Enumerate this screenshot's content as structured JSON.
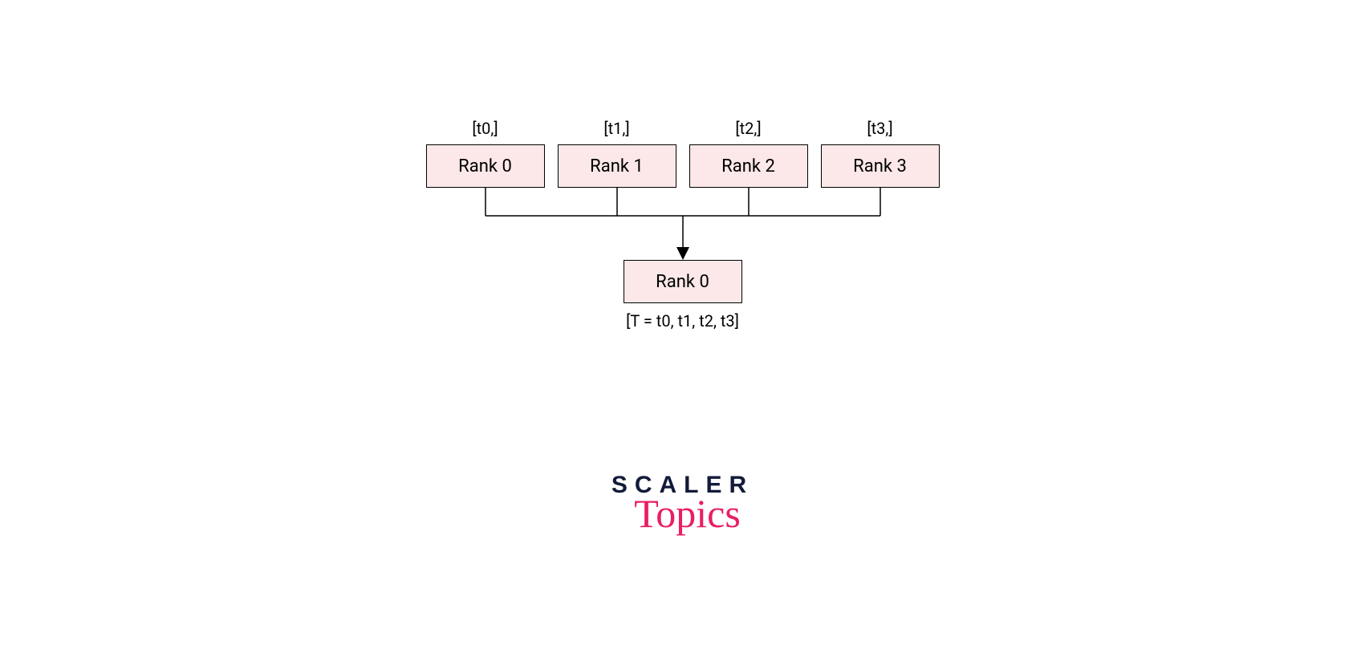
{
  "nodes": {
    "top": [
      {
        "label": "[t0,]",
        "box": "Rank 0"
      },
      {
        "label": "[t1,]",
        "box": "Rank 1"
      },
      {
        "label": "[t2,]",
        "box": "Rank 2"
      },
      {
        "label": "[t3,]",
        "box": "Rank 3"
      }
    ],
    "bottom": {
      "box": "Rank 0",
      "label": "[T = t0, t1, t2, t3]"
    }
  },
  "logo": {
    "line1": "SCALER",
    "line2": "Topics"
  },
  "colors": {
    "box_fill": "#fce8e8",
    "box_border": "#000000",
    "logo_dark": "#131a3a",
    "logo_pink": "#e91e63"
  }
}
